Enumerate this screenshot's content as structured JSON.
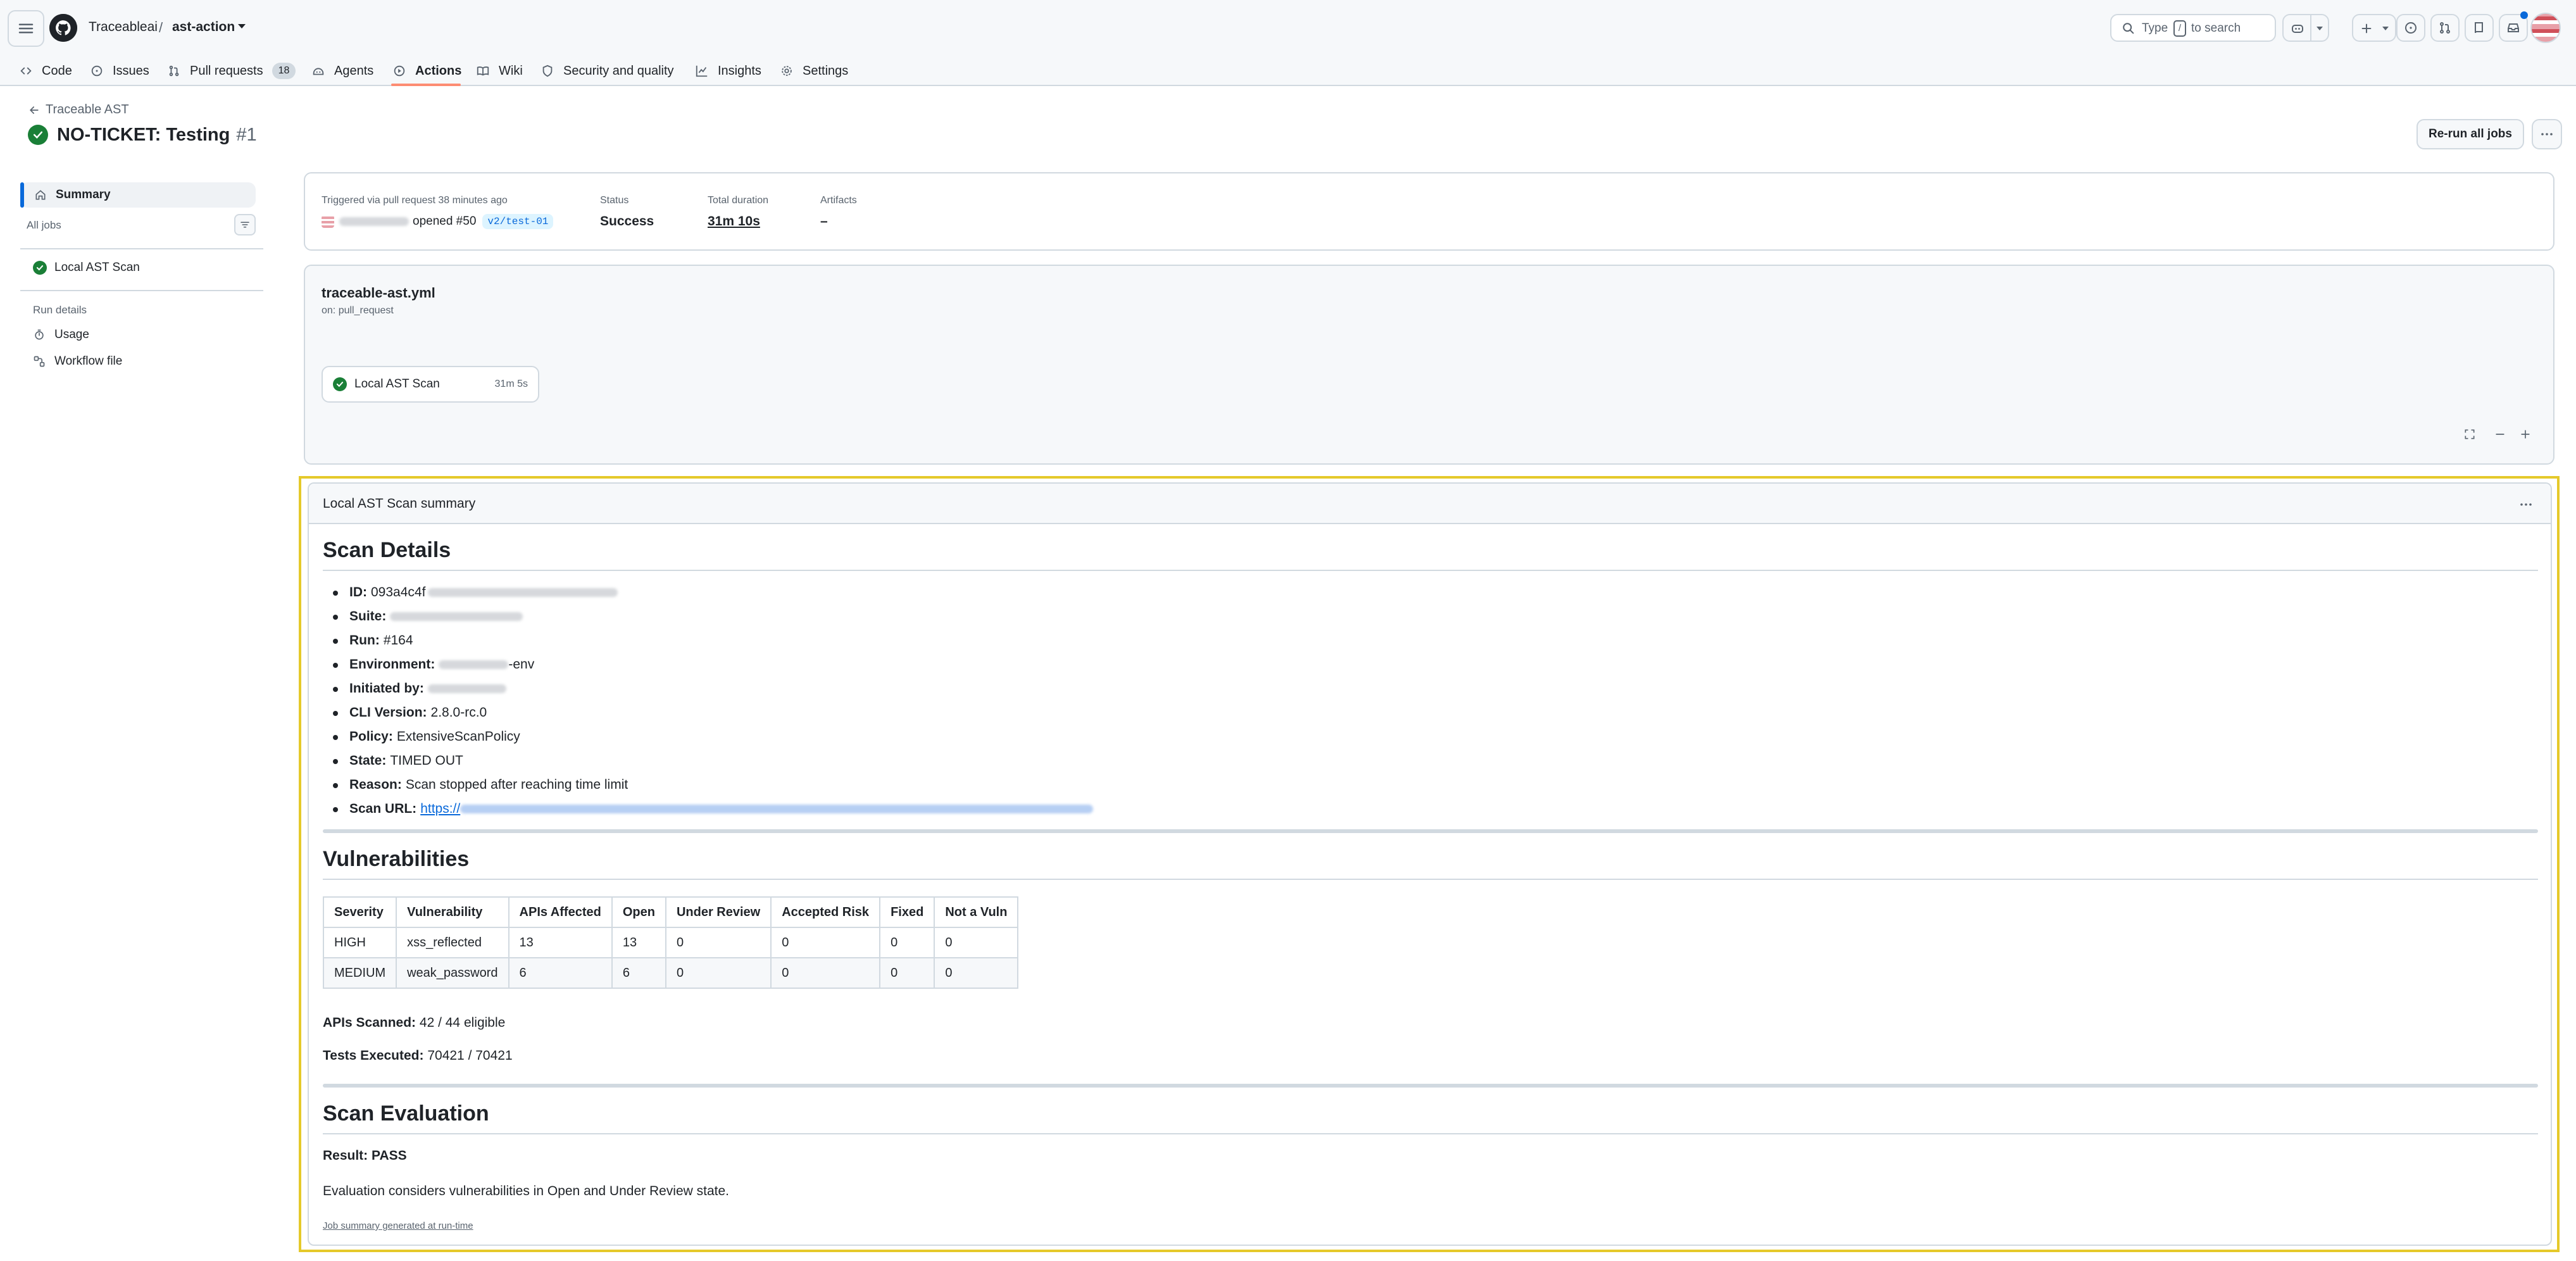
{
  "header": {
    "owner": "Traceableai",
    "separator": "/",
    "repo": "ast-action",
    "search": {
      "type_label": "Type",
      "key": "/",
      "rest_label": "to search"
    }
  },
  "nav": {
    "tabs": [
      {
        "label": "Code",
        "icon": "code-icon"
      },
      {
        "label": "Issues",
        "icon": "issue-icon"
      },
      {
        "label": "Pull requests",
        "icon": "pull-request-icon",
        "count": "18"
      },
      {
        "label": "Agents",
        "icon": "agent-icon"
      },
      {
        "label": "Actions",
        "icon": "play-icon",
        "active": true
      },
      {
        "label": "Wiki",
        "icon": "book-icon"
      },
      {
        "label": "Security and quality",
        "icon": "shield-icon"
      },
      {
        "label": "Insights",
        "icon": "graph-icon"
      },
      {
        "label": "Settings",
        "icon": "gear-icon"
      }
    ],
    "accent": "#fd8c73"
  },
  "run": {
    "back_label": "Traceable AST",
    "title": "NO-TICKET: Testing",
    "number": "#1",
    "rerun_label": "Re-run all jobs",
    "status_color": "#1a7f37"
  },
  "sidebar": {
    "summary_label": "Summary",
    "all_jobs_label": "All jobs",
    "job_label": "Local AST Scan",
    "run_details_label": "Run details",
    "usage_label": "Usage",
    "workflow_file_label": "Workflow file"
  },
  "meta": {
    "trigger_label": "Triggered via pull request 38 minutes ago",
    "trigger_text": "opened #50",
    "branch": "v2/test-01",
    "status_label": "Status",
    "status_value": "Success",
    "duration_label": "Total duration",
    "duration_value": "31m 10s",
    "artifacts_label": "Artifacts",
    "artifacts_value": "–"
  },
  "workflow": {
    "file": "traceable-ast.yml",
    "trigger": "on: pull_request",
    "job_name": "Local AST Scan",
    "job_time": "31m 5s"
  },
  "summary": {
    "header": "Local AST Scan summary",
    "scan_details_heading": "Scan Details",
    "details": [
      {
        "label": "ID:",
        "value": "093a4c4f"
      },
      {
        "label": "Suite:",
        "value": ""
      },
      {
        "label": "Run:",
        "value": "#164"
      },
      {
        "label": "Environment:",
        "value": "-env"
      },
      {
        "label": "Initiated by:",
        "value": ""
      },
      {
        "label": "CLI Version:",
        "value": "2.8.0-rc.0"
      },
      {
        "label": "Policy:",
        "value": "ExtensiveScanPolicy"
      },
      {
        "label": "State:",
        "value": "TIMED OUT"
      },
      {
        "label": "Reason:",
        "value": "Scan stopped after reaching time limit"
      },
      {
        "label": "Scan URL:",
        "value": "https://"
      }
    ],
    "vulnerabilities_heading": "Vulnerabilities",
    "table": {
      "headers": [
        "Severity",
        "Vulnerability",
        "APIs Affected",
        "Open",
        "Under Review",
        "Accepted Risk",
        "Fixed",
        "Not a Vuln"
      ],
      "rows": [
        [
          "HIGH",
          "xss_reflected",
          "13",
          "13",
          "0",
          "0",
          "0",
          "0"
        ],
        [
          "MEDIUM",
          "weak_password",
          "6",
          "6",
          "0",
          "0",
          "0",
          "0"
        ]
      ]
    },
    "apis_scanned_label": "APIs Scanned:",
    "apis_scanned_value": "42 / 44 eligible",
    "tests_executed_label": "Tests Executed:",
    "tests_executed_value": "70421 / 70421",
    "evaluation_heading": "Scan Evaluation",
    "result_text": "Result: PASS",
    "evaluation_note": "Evaluation considers vulnerabilities in Open and Under Review state.",
    "footer_link": "Job summary generated at run-time",
    "highlight_color": "#e5c92a"
  }
}
